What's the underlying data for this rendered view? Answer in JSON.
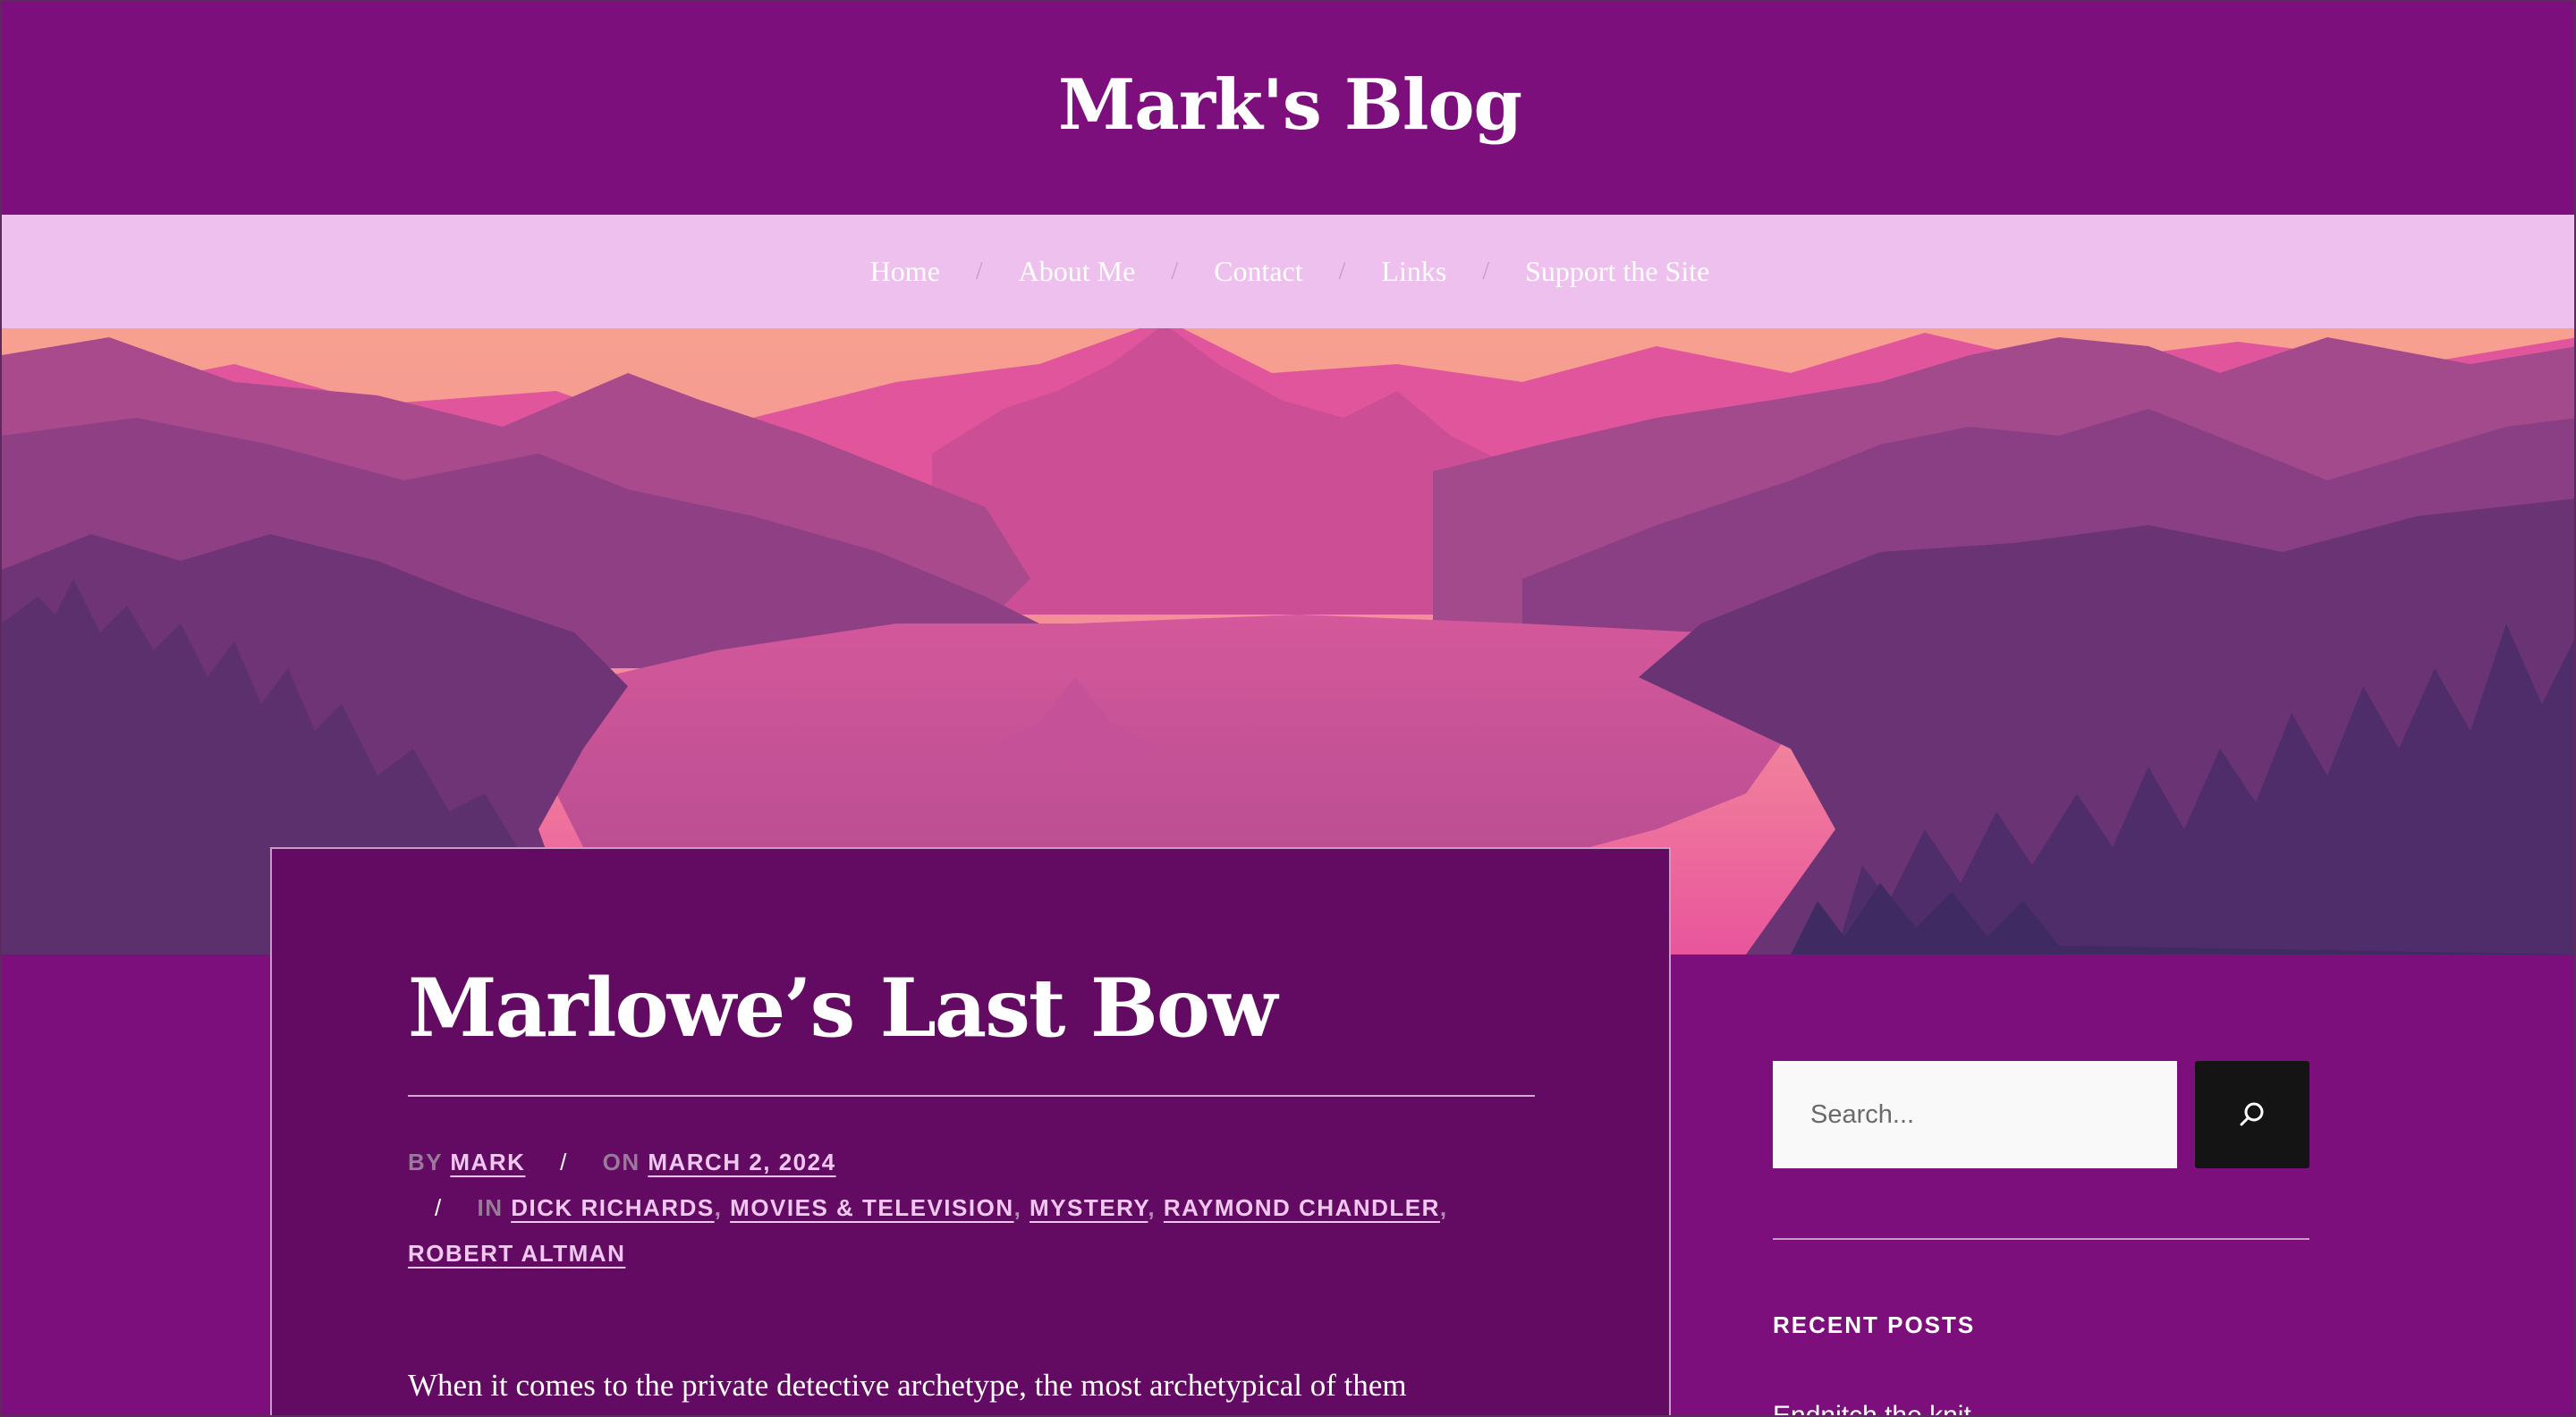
{
  "site": {
    "title": "Mark's Blog"
  },
  "nav": {
    "items": [
      {
        "label": "Home"
      },
      {
        "label": "About Me"
      },
      {
        "label": "Contact"
      },
      {
        "label": "Links"
      },
      {
        "label": "Support the Site"
      }
    ],
    "separator": "/"
  },
  "post": {
    "title": "Marlowe’s Last Bow",
    "meta": {
      "by_label": "BY",
      "author": "MARK",
      "on_label": "ON",
      "date": "MARCH 2, 2024",
      "in_label": "IN",
      "categories": [
        "DICK RICHARDS",
        "MOVIES & TELEVISION",
        "MYSTERY",
        "RAYMOND CHANDLER",
        "ROBERT ALTMAN"
      ]
    },
    "excerpt": "When it comes to the private detective archetype, the most archetypical of them"
  },
  "sidebar": {
    "search": {
      "placeholder": "Search..."
    },
    "recent_posts": {
      "heading": "RECENT POSTS",
      "first_item_partial": "Endnitch the knit"
    }
  },
  "colors": {
    "header_bg": "#7d0f7d",
    "nav_bg": "#eec0ee",
    "card_bg": "#630a62",
    "search_button_bg": "#141414"
  }
}
